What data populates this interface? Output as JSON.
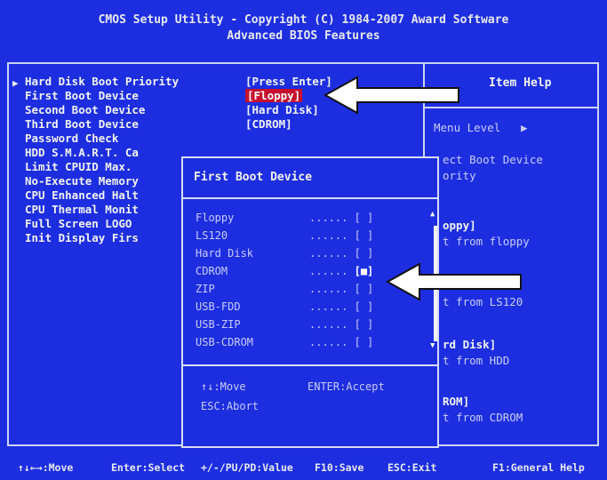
{
  "header": {
    "line1": "CMOS Setup Utility - Copyright (C) 1984-2007 Award Software",
    "line2": "Advanced BIOS Features"
  },
  "menu": [
    {
      "label": "Hard Disk Boot Priority",
      "value": "[Press Enter]"
    },
    {
      "label": "First Boot Device",
      "value": "[Floppy]"
    },
    {
      "label": "Second Boot Device",
      "value": "[Hard Disk]"
    },
    {
      "label": "Third Boot Device",
      "value": "[CDROM]"
    },
    {
      "label": "Password Check"
    },
    {
      "label": "HDD S.M.A.R.T. Ca"
    },
    {
      "label": "Limit CPUID Max."
    },
    {
      "label": "No-Execute Memory"
    },
    {
      "label": "CPU Enhanced Halt"
    },
    {
      "label": "CPU Thermal Monit"
    },
    {
      "label": "Full Screen LOGO"
    },
    {
      "label": "Init Display Firs"
    }
  ],
  "help": {
    "title": "Item Help",
    "menu_level": "Menu Level",
    "menu_level_icon": "right-triangle",
    "lines": [
      "ect Boot Device",
      "ority",
      "oppy]",
      "t from floppy",
      "t from LS120",
      "rd Disk]",
      "t from HDD",
      "ROM]",
      "t from CDROM"
    ]
  },
  "popup": {
    "title": "First Boot Device",
    "dots": "......",
    "options": [
      {
        "label": "Floppy",
        "mark": "[ ]"
      },
      {
        "label": "LS120",
        "mark": "[ ]"
      },
      {
        "label": "Hard Disk",
        "mark": "[ ]"
      },
      {
        "label": "CDROM",
        "mark": "[■]"
      },
      {
        "label": "ZIP",
        "mark": "[ ]"
      },
      {
        "label": "USB-FDD",
        "mark": "[ ]"
      },
      {
        "label": "USB-ZIP",
        "mark": "[ ]"
      },
      {
        "label": "USB-CDROM",
        "mark": "[ ]"
      }
    ],
    "keys": {
      "move": "↑↓:Move",
      "accept": "ENTER:Accept",
      "abort": "ESC:Abort"
    }
  },
  "footer": {
    "move": "↑↓←→:Move",
    "select": "Enter:Select",
    "value": "+/-/PU/PD:Value",
    "save": "F10:Save",
    "exit": "ESC:Exit",
    "help": "F1:General Help"
  },
  "colors": {
    "background": "#1d2ee0",
    "highlight": "#c8102e",
    "arrow": "#ffffff"
  }
}
